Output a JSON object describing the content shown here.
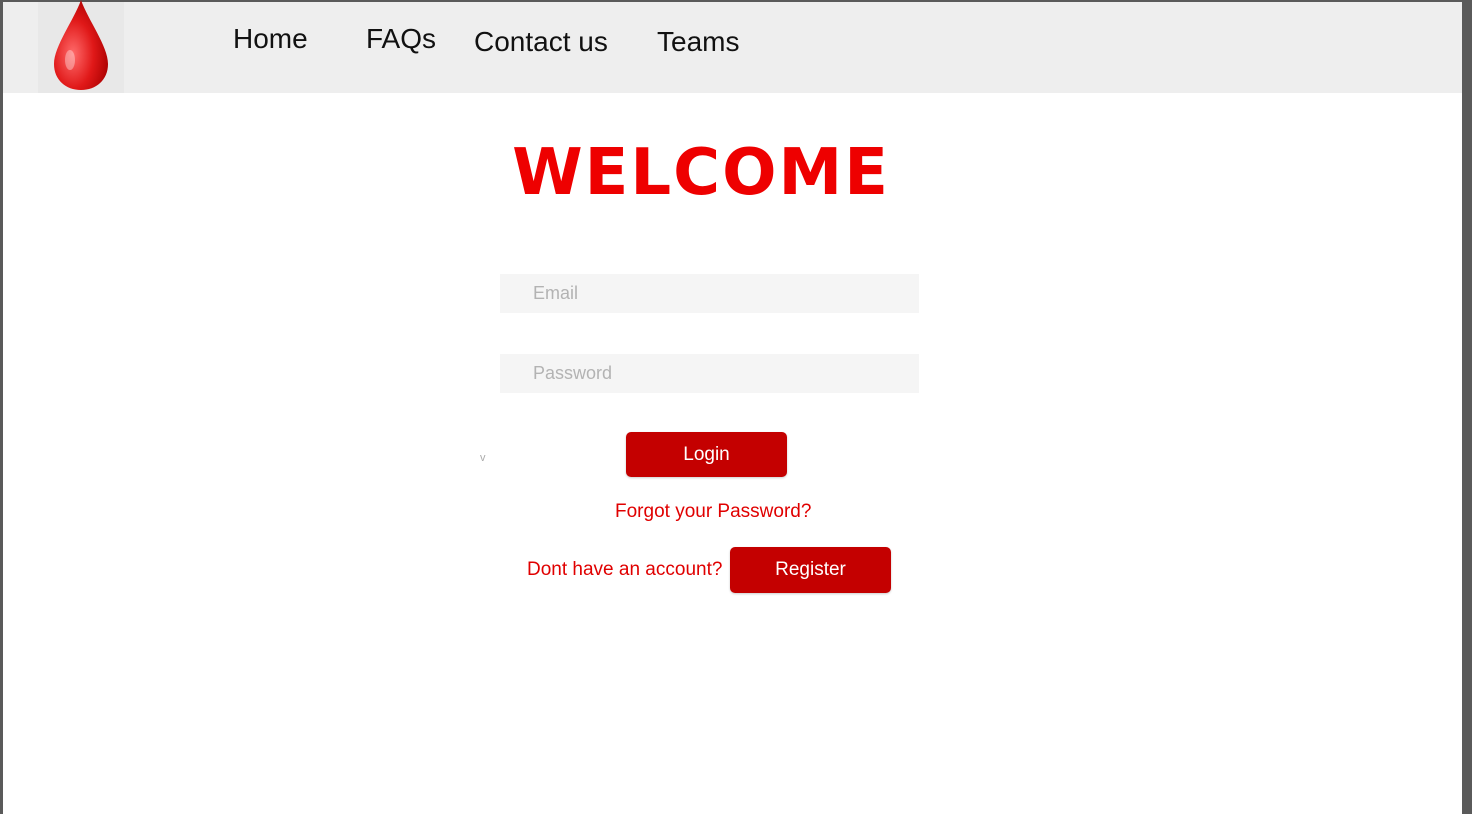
{
  "nav": {
    "links": [
      {
        "label": "Home"
      },
      {
        "label": "FAQs"
      },
      {
        "label": "Contact us"
      },
      {
        "label": "Teams"
      }
    ],
    "logo_icon": "blood-drop-icon"
  },
  "main": {
    "title": "WELCOME",
    "email": {
      "placeholder": "Email",
      "value": ""
    },
    "password": {
      "placeholder": "Password",
      "value": ""
    },
    "login_label": "Login",
    "stray_mark": "v",
    "forgot_label": "Forgot your Password?",
    "account_prompt": "Dont have an account?",
    "register_label": "Register"
  },
  "colors": {
    "accent_red": "#ee0000",
    "button_red": "#c40000",
    "navbar_bg": "#eeeeee",
    "input_bg": "#f5f5f5"
  }
}
